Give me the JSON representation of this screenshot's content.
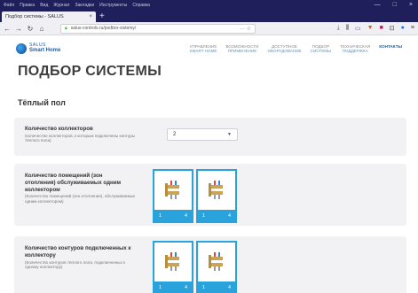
{
  "browser": {
    "menu": [
      "Файл",
      "Правка",
      "Вид",
      "Журнал",
      "Закладки",
      "Инструменты",
      "Справка"
    ],
    "tab_title": "Подбор системы - SALUS",
    "tab_close": "×",
    "new_tab": "+",
    "url": "salus-controls.ru/podbor-sistemy/",
    "url_extra": "··· ☆",
    "window_controls": [
      "—",
      "□",
      "×"
    ]
  },
  "site": {
    "brand_line1": "SALUS",
    "brand_line2": "Smart Home",
    "nav": [
      {
        "top": "Управление",
        "bottom": "Smart Home"
      },
      {
        "top": "Возможности",
        "bottom": "Применение"
      },
      {
        "top": "Доступное",
        "bottom": "Оборудование"
      },
      {
        "top": "Подбор",
        "bottom": "Системы"
      },
      {
        "top": "Техническая",
        "bottom": "Поддержка"
      },
      {
        "top": "",
        "bottom": "Контакты"
      }
    ]
  },
  "page": {
    "title": "ПОДБОР СИСТЕМЫ",
    "section": "Тёплый пол"
  },
  "questions": [
    {
      "label": "Количество коллекторов",
      "hint": "(количество коллекторов, к которым подключены контуры тёплого пола)",
      "control": "select",
      "value": "2"
    },
    {
      "label": "Количество помещений (зон отопления) обслуживаемых одним коллектором",
      "hint": "(Количество помещений (зон отопления), обслуживаемых одним коллектором)",
      "control": "options",
      "options": [
        {
          "left": "1",
          "right": "4"
        },
        {
          "left": "1",
          "right": "4"
        }
      ]
    },
    {
      "label": "Количество контуров подключенных к коллектору",
      "hint": "(Количество контуров тёплого пола, подключенных к одному коллектору)",
      "control": "options",
      "options": [
        {
          "left": "1",
          "right": "4"
        },
        {
          "left": "1",
          "right": "4"
        }
      ]
    }
  ]
}
